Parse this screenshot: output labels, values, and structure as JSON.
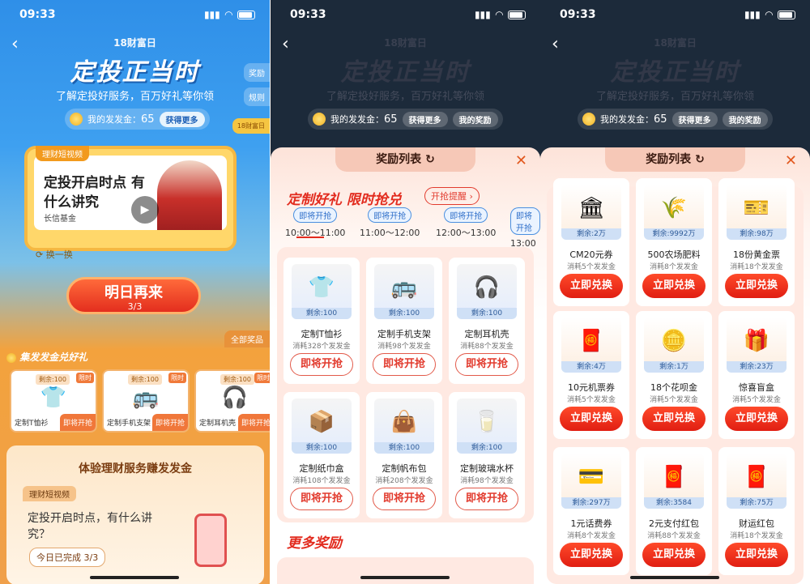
{
  "status": {
    "time": "09:33"
  },
  "header": {
    "brand": "18财富日",
    "title": "定投正当时",
    "subtitle": "了解定投好服务，百万好礼等你领",
    "side_tab_reward": "奖励",
    "side_tab_rules": "规则",
    "gold_label": "我的发发金：",
    "gold_value": "65",
    "get_more": "获得更多",
    "my_rewards": "我的奖励",
    "badge": "18财富日"
  },
  "screen1": {
    "video_tag": "理财短视频",
    "video_title": "定投开启时点 有什么讲究",
    "fund_name": "长信基金",
    "swap": "换一换",
    "main_button": "明日再来",
    "main_progress": "3/3",
    "all_prizes": "全部奖品",
    "section_title": "集发发金兑好礼",
    "mini_items": [
      {
        "label": "定制T恤衫",
        "remain": "剩余:100",
        "limit": "限时",
        "action": "即将开抢"
      },
      {
        "label": "定制手机支架",
        "remain": "剩余:100",
        "limit": "限时",
        "action": "即将开抢"
      },
      {
        "label": "定制耳机壳",
        "remain": "剩余:100",
        "limit": "限时",
        "action": "即将开抢"
      }
    ],
    "exp_title": "体验理财服务赚发发金",
    "exp_tag": "理财短视频",
    "exp_text": "定投开启时点，有什么讲究？",
    "exp_done": "今日已完成 3/3"
  },
  "modal": {
    "title": "奖励列表",
    "promo_title": "定制好礼 限时抢兑",
    "remind_button": "开抢提醒",
    "slots": [
      {
        "status": "即将开抢",
        "time": "10:00～11:00"
      },
      {
        "status": "即将开抢",
        "time": "11:00～12:00"
      },
      {
        "status": "即将开抢",
        "time": "12:00～13:00"
      },
      {
        "status": "即将开抢",
        "time": "13:00～"
      }
    ],
    "products": [
      {
        "name": "定制T恤衫",
        "remain": "剩余:100",
        "cost": "消耗328个发发金",
        "action": "即将开抢"
      },
      {
        "name": "定制手机支架",
        "remain": "剩余:100",
        "cost": "消耗98个发发金",
        "action": "即将开抢"
      },
      {
        "name": "定制耳机壳",
        "remain": "剩余:100",
        "cost": "消耗88个发发金",
        "action": "即将开抢"
      },
      {
        "name": "定制纸巾盒",
        "remain": "剩余:100",
        "cost": "消耗108个发发金",
        "action": "即将开抢"
      },
      {
        "name": "定制帆布包",
        "remain": "剩余:100",
        "cost": "消耗208个发发金",
        "action": "即将开抢"
      },
      {
        "name": "定制玻璃水杯",
        "remain": "剩余:100",
        "cost": "消耗98个发发金",
        "action": "即将开抢"
      }
    ],
    "more_title": "更多奖励"
  },
  "rewards": [
    {
      "name": "CM20元券",
      "remain": "剩余:2万",
      "cost": "消耗5个发发金",
      "action": "立即兑换",
      "icon": "house-icon"
    },
    {
      "name": "500农场肥料",
      "remain": "剩余:9992万",
      "cost": "消耗8个发发金",
      "action": "立即兑换",
      "icon": "fertilizer-icon"
    },
    {
      "name": "18份黄金票",
      "remain": "剩余:98万",
      "cost": "消耗18个发发金",
      "action": "立即兑换",
      "icon": "gold-ticket-icon"
    },
    {
      "name": "10元机票券",
      "remain": "剩余:4万",
      "cost": "消耗5个发发金",
      "action": "立即兑换",
      "icon": "red-envelope-icon"
    },
    {
      "name": "18个花呗金",
      "remain": "剩余:1万",
      "cost": "消耗5个发发金",
      "action": "立即兑换",
      "icon": "gold-coin-icon"
    },
    {
      "name": "惊喜盲盒",
      "remain": "剩余:23万",
      "cost": "消耗5个发发金",
      "action": "立即兑换",
      "icon": "mystery-box-icon"
    },
    {
      "name": "1元话费券",
      "remain": "剩余:297万",
      "cost": "消耗8个发发金",
      "action": "立即兑换",
      "icon": "coupon-icon"
    },
    {
      "name": "2元支付红包",
      "remain": "剩余:3584",
      "cost": "消耗88个发发金",
      "action": "立即兑换",
      "icon": "red-packet-icon"
    },
    {
      "name": "财运红包",
      "remain": "剩余:75万",
      "cost": "消耗18个发发金",
      "action": "立即兑换",
      "icon": "fortune-packet-icon"
    }
  ],
  "icons": {
    "back": "chevron-left-icon",
    "close": "close-icon",
    "refresh": "refresh-icon"
  },
  "colors": {
    "accent_red": "#e22b1e",
    "brand_blue": "#2f8fe8",
    "gold": "#f2b01e"
  }
}
